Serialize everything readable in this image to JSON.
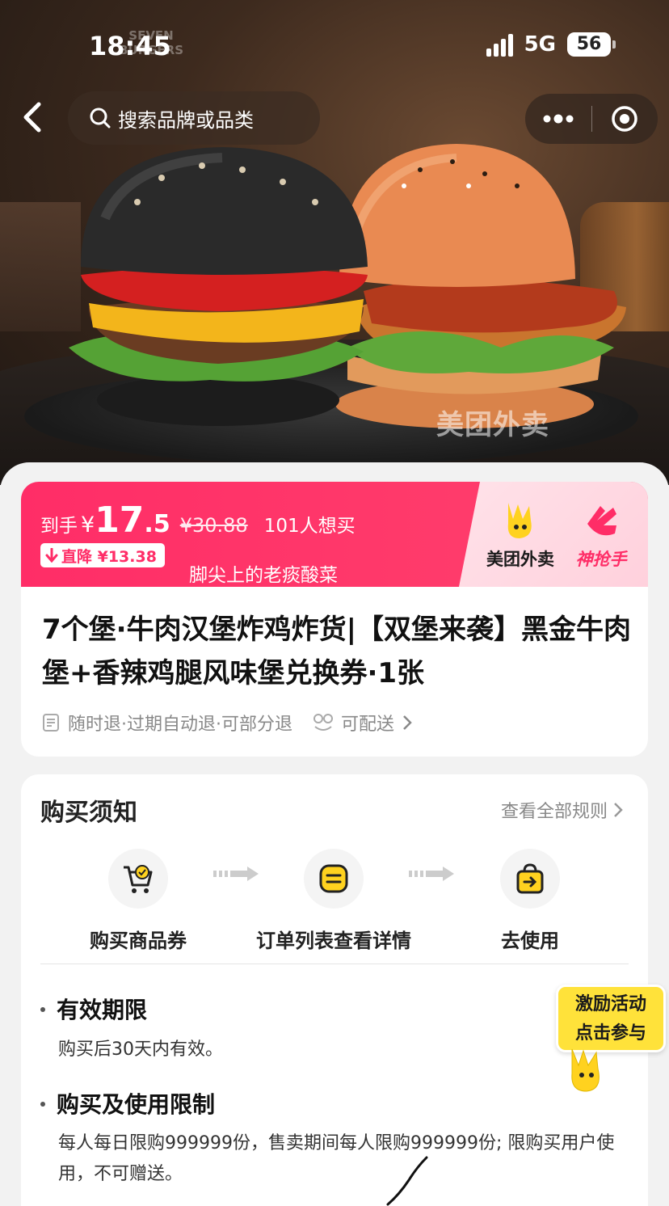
{
  "status_bar": {
    "time": "18:45",
    "network": "5G",
    "battery": "56"
  },
  "nav": {
    "search_placeholder": "搜索品牌或品类"
  },
  "hero": {
    "watermark": "美团外卖",
    "logo_text": "SEVEN BURGERS"
  },
  "price": {
    "label": "到手",
    "currency": "¥",
    "integer": "17",
    "decimal": ".5",
    "original": "¥30.88",
    "want_count": "101人想买",
    "drop_label": "直降 ¥13.38",
    "shop_name": "脚尖上的老痰酸菜",
    "brand_meituan": "美团外卖",
    "brand_shenqiang": "神抢手"
  },
  "product": {
    "title": "7个堡·牛肉汉堡炸鸡炸货|【双堡来袭】黑金牛肉堡+香辣鸡腿风味堡兑换券·1张",
    "refund_policy": "随时退·过期自动退·可部分退",
    "delivery": "可配送"
  },
  "notice": {
    "title": "购买须知",
    "rules_link": "查看全部规则",
    "steps": [
      {
        "label": "购买商品券",
        "icon": "cart-icon"
      },
      {
        "label": "订单列表查看详情",
        "icon": "order-list-icon"
      },
      {
        "label": "去使用",
        "icon": "use-bag-icon"
      }
    ],
    "sections": [
      {
        "title": "有效期限",
        "body": "购买后30天内有效。"
      },
      {
        "title": "购买及使用限制",
        "body": "每人每日限购999999份，售卖期间每人限购999999份; 限购买用户使用，不可赠送。"
      }
    ]
  },
  "promo": {
    "line1": "激励活动",
    "line2": "点击参与"
  },
  "colors": {
    "accent": "#ff2d67",
    "promo_yellow": "#ffe23a"
  }
}
